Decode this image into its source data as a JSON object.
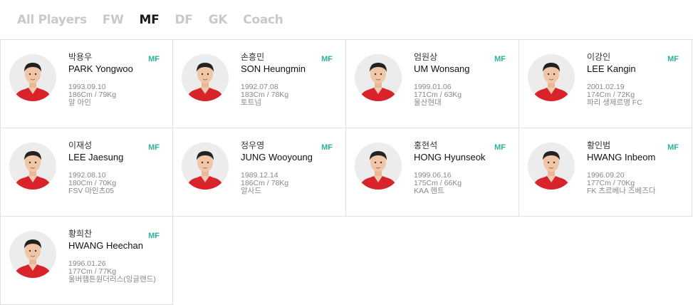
{
  "tabs": [
    {
      "label": "All Players",
      "active": false
    },
    {
      "label": "FW",
      "active": false
    },
    {
      "label": "MF",
      "active": true
    },
    {
      "label": "DF",
      "active": false
    },
    {
      "label": "GK",
      "active": false
    },
    {
      "label": "Coach",
      "active": false
    }
  ],
  "players": [
    {
      "kname": "박용우",
      "ename": "PARK Yongwoo",
      "pos": "MF",
      "birth": "1993.09.10",
      "body": "186Cm / 79Kg",
      "club": "알 아인"
    },
    {
      "kname": "손흥민",
      "ename": "SON Heungmin",
      "pos": "MF",
      "birth": "1992.07.08",
      "body": "183Cm / 78Kg",
      "club": "토트넘"
    },
    {
      "kname": "엄원상",
      "ename": "UM Wonsang",
      "pos": "MF",
      "birth": "1999.01.06",
      "body": "171Cm / 63Kg",
      "club": "울산현대"
    },
    {
      "kname": "이강인",
      "ename": "LEE Kangin",
      "pos": "MF",
      "birth": "2001.02.19",
      "body": "174Cm / 72Kg",
      "club": "파리 생제르맹 FC"
    },
    {
      "kname": "이재성",
      "ename": "LEE Jaesung",
      "pos": "MF",
      "birth": "1992.08.10",
      "body": "180Cm / 70Kg",
      "club": "FSV 마인츠05"
    },
    {
      "kname": "정우영",
      "ename": "JUNG Wooyoung",
      "pos": "MF",
      "birth": "1989.12.14",
      "body": "186Cm / 78Kg",
      "club": "알사드"
    },
    {
      "kname": "홍현석",
      "ename": "HONG Hyunseok",
      "pos": "MF",
      "birth": "1999.06.16",
      "body": "175Cm / 66Kg",
      "club": "KAA 헨트"
    },
    {
      "kname": "황인범",
      "ename": "HWANG Inbeom",
      "pos": "MF",
      "birth": "1996.09.20",
      "body": "177Cm / 70Kg",
      "club": "FK 츠르베나 즈베즈다"
    },
    {
      "kname": "황희찬",
      "ename": "HWANG Heechan",
      "pos": "MF",
      "birth": "1996.01.26",
      "body": "177Cm / 77Kg",
      "club": "울버햄튼원더러스(잉글랜드)"
    }
  ]
}
